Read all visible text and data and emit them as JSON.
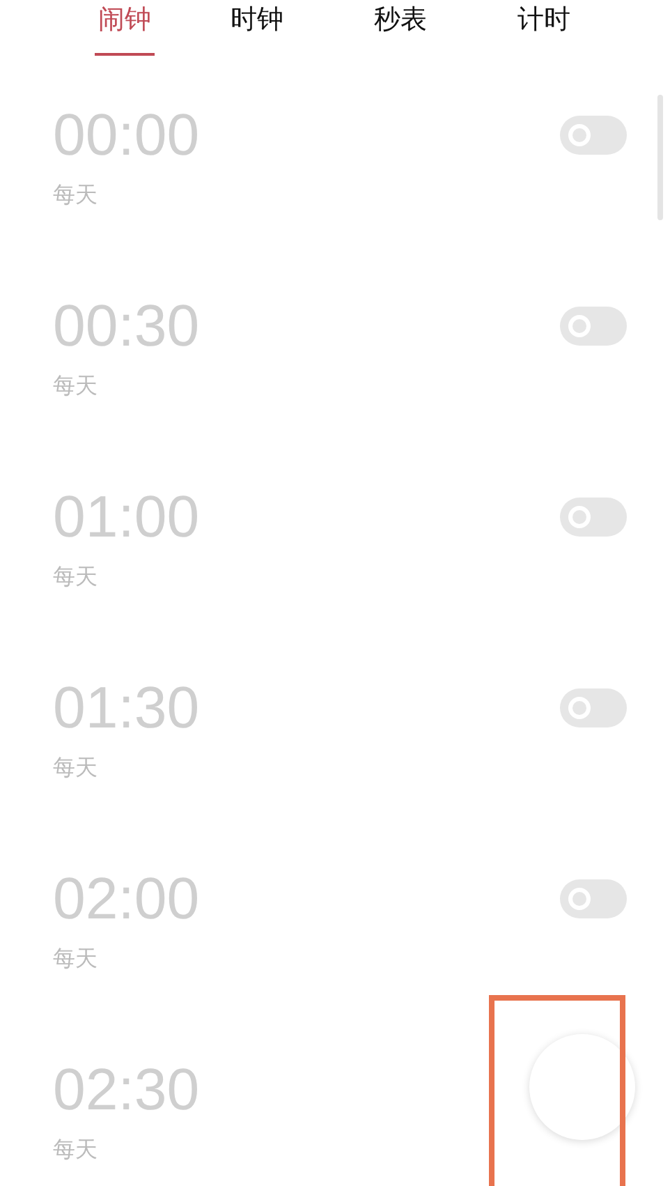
{
  "tabs": [
    {
      "label": "闹钟",
      "selected": true
    },
    {
      "label": "时钟",
      "selected": false
    },
    {
      "label": "秒表",
      "selected": false
    },
    {
      "label": "计时",
      "selected": false
    }
  ],
  "alarms": [
    {
      "time": "00:00",
      "repeat": "每天",
      "on": false
    },
    {
      "time": "00:30",
      "repeat": "每天",
      "on": false
    },
    {
      "time": "01:00",
      "repeat": "每天",
      "on": false
    },
    {
      "time": "01:30",
      "repeat": "每天",
      "on": false
    },
    {
      "time": "02:00",
      "repeat": "每天",
      "on": false
    },
    {
      "time": "02:30",
      "repeat": "每天"
    }
  ]
}
